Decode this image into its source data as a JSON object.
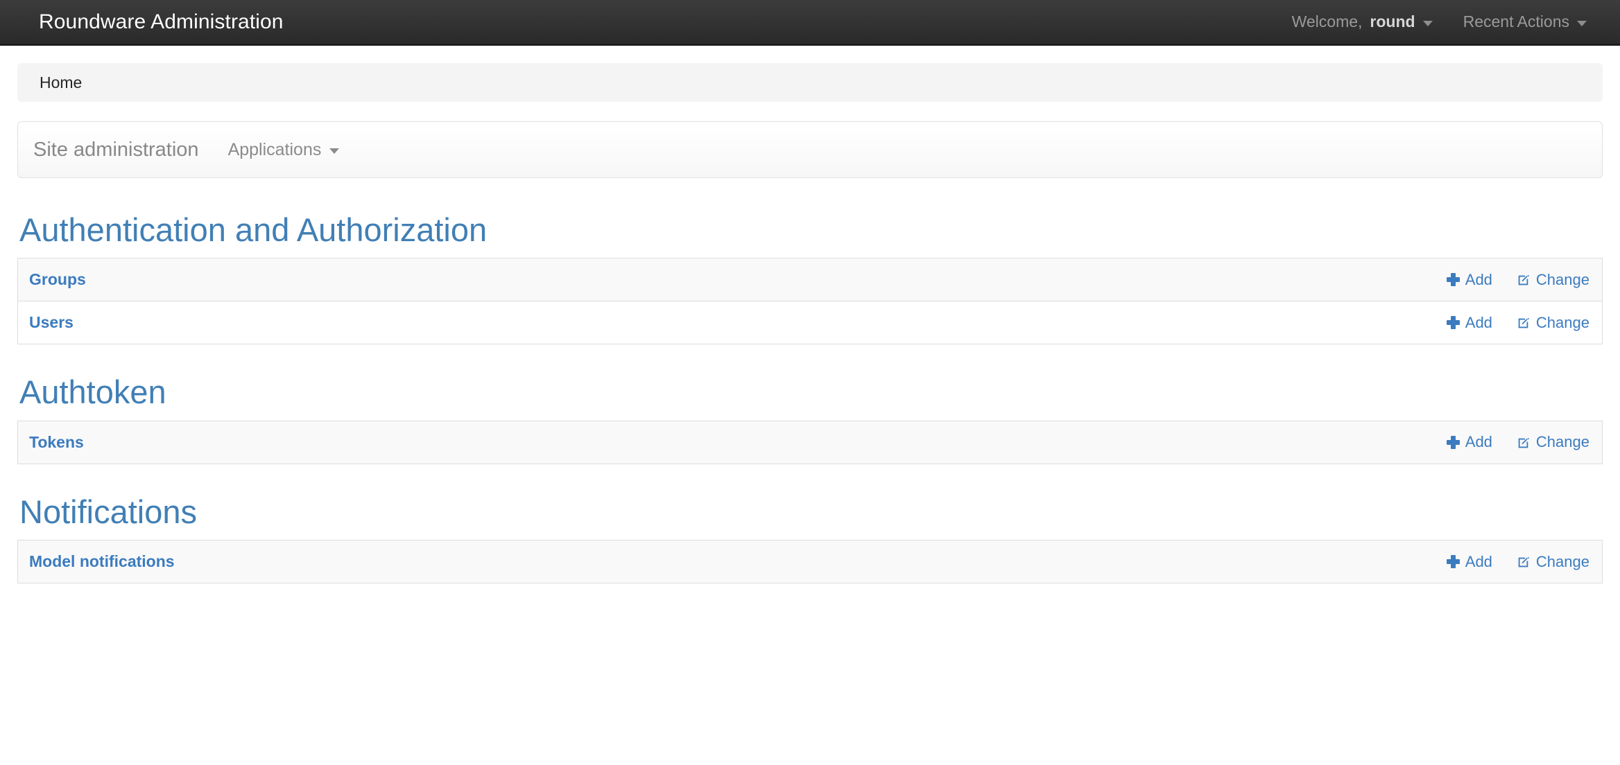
{
  "navbar": {
    "brand": "Roundware Administration",
    "welcome_prefix": "Welcome,",
    "welcome_user": "round",
    "recent_actions_label": "Recent Actions"
  },
  "breadcrumb": {
    "items": [
      "Home"
    ]
  },
  "site_panel": {
    "title": "Site administration",
    "menu_label": "Applications"
  },
  "actions": {
    "add_label": "Add",
    "change_label": "Change"
  },
  "colors": {
    "link_blue": "#3b7bbf",
    "heading_blue": "#417fb5",
    "navbar_dark": "#333333",
    "row_odd": "#f9f9f9",
    "row_even": "#ffffff",
    "border": "#dddddd"
  },
  "apps": [
    {
      "name": "Authentication and Authorization",
      "models": [
        {
          "name": "Groups",
          "add": "Add",
          "change": "Change"
        },
        {
          "name": "Users",
          "add": "Add",
          "change": "Change"
        }
      ]
    },
    {
      "name": "Authtoken",
      "models": [
        {
          "name": "Tokens",
          "add": "Add",
          "change": "Change"
        }
      ]
    },
    {
      "name": "Notifications",
      "models": [
        {
          "name": "Model notifications",
          "add": "Add",
          "change": "Change"
        }
      ]
    }
  ]
}
